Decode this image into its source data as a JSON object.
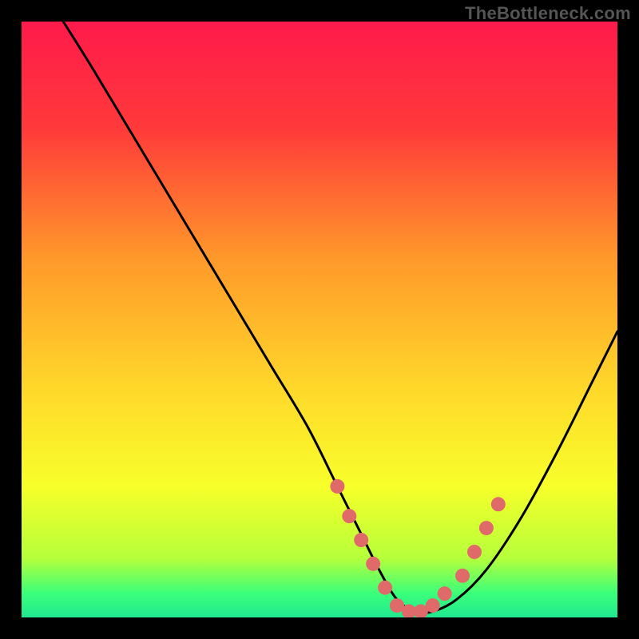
{
  "watermark": "TheBottleneck.com",
  "chart_data": {
    "type": "line",
    "title": "",
    "xlabel": "",
    "ylabel": "",
    "xlim": [
      0,
      100
    ],
    "ylim": [
      0,
      100
    ],
    "gradient_stops": [
      {
        "offset": 0,
        "color": "#ff1a4b"
      },
      {
        "offset": 18,
        "color": "#ff3a3a"
      },
      {
        "offset": 40,
        "color": "#ff9a2a"
      },
      {
        "offset": 62,
        "color": "#ffd92a"
      },
      {
        "offset": 78,
        "color": "#f7ff2a"
      },
      {
        "offset": 90,
        "color": "#b6ff3a"
      },
      {
        "offset": 96,
        "color": "#3aff7a"
      },
      {
        "offset": 100,
        "color": "#20e890"
      }
    ],
    "curve": {
      "x": [
        7,
        12,
        18,
        24,
        30,
        36,
        42,
        48,
        53,
        57,
        60,
        63,
        66,
        69,
        73,
        78,
        84,
        90,
        96,
        100
      ],
      "y": [
        100,
        92,
        82,
        72,
        62,
        52,
        42,
        32,
        22,
        14,
        8,
        3,
        1,
        1,
        3,
        8,
        17,
        28,
        40,
        48
      ]
    },
    "markers": {
      "x": [
        53,
        55,
        57,
        59,
        61,
        63,
        65,
        67,
        69,
        71,
        74,
        76,
        78,
        80
      ],
      "y": [
        22,
        17,
        13,
        9,
        5,
        2,
        1,
        1,
        2,
        4,
        7,
        11,
        15,
        19
      ],
      "color": "#e06a6a",
      "radius": 9
    }
  }
}
